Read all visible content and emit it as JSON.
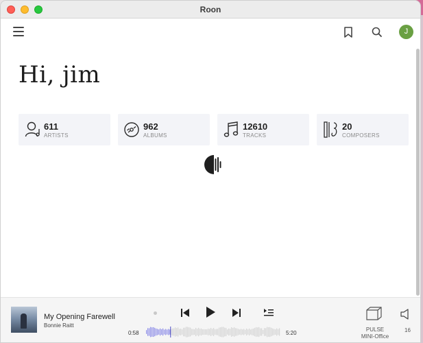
{
  "window": {
    "title": "Roon"
  },
  "header": {
    "avatar_initial": "J"
  },
  "home": {
    "greeting": "Hi, jim",
    "stats": [
      {
        "value": "611",
        "label": "ARTISTS",
        "icon": "artist-icon"
      },
      {
        "value": "962",
        "label": "ALBUMS",
        "icon": "album-icon"
      },
      {
        "value": "12610",
        "label": "TRACKS",
        "icon": "music-note-icon"
      },
      {
        "value": "20",
        "label": "COMPOSERS",
        "icon": "composer-icon"
      }
    ]
  },
  "player": {
    "track_title": "My Opening Farewell",
    "artist": "Bonnie Raitt",
    "elapsed": "0:58",
    "duration": "5:20",
    "progress_fraction": 0.18,
    "zone_line1": "PULSE",
    "zone_line2": "MINI-Office",
    "volume": "16"
  },
  "colors": {
    "avatar": "#6aa043",
    "waveform_played": "#8e8ee8",
    "waveform_remaining": "#d5d5d5",
    "stat_tile": "#f3f4f8"
  }
}
